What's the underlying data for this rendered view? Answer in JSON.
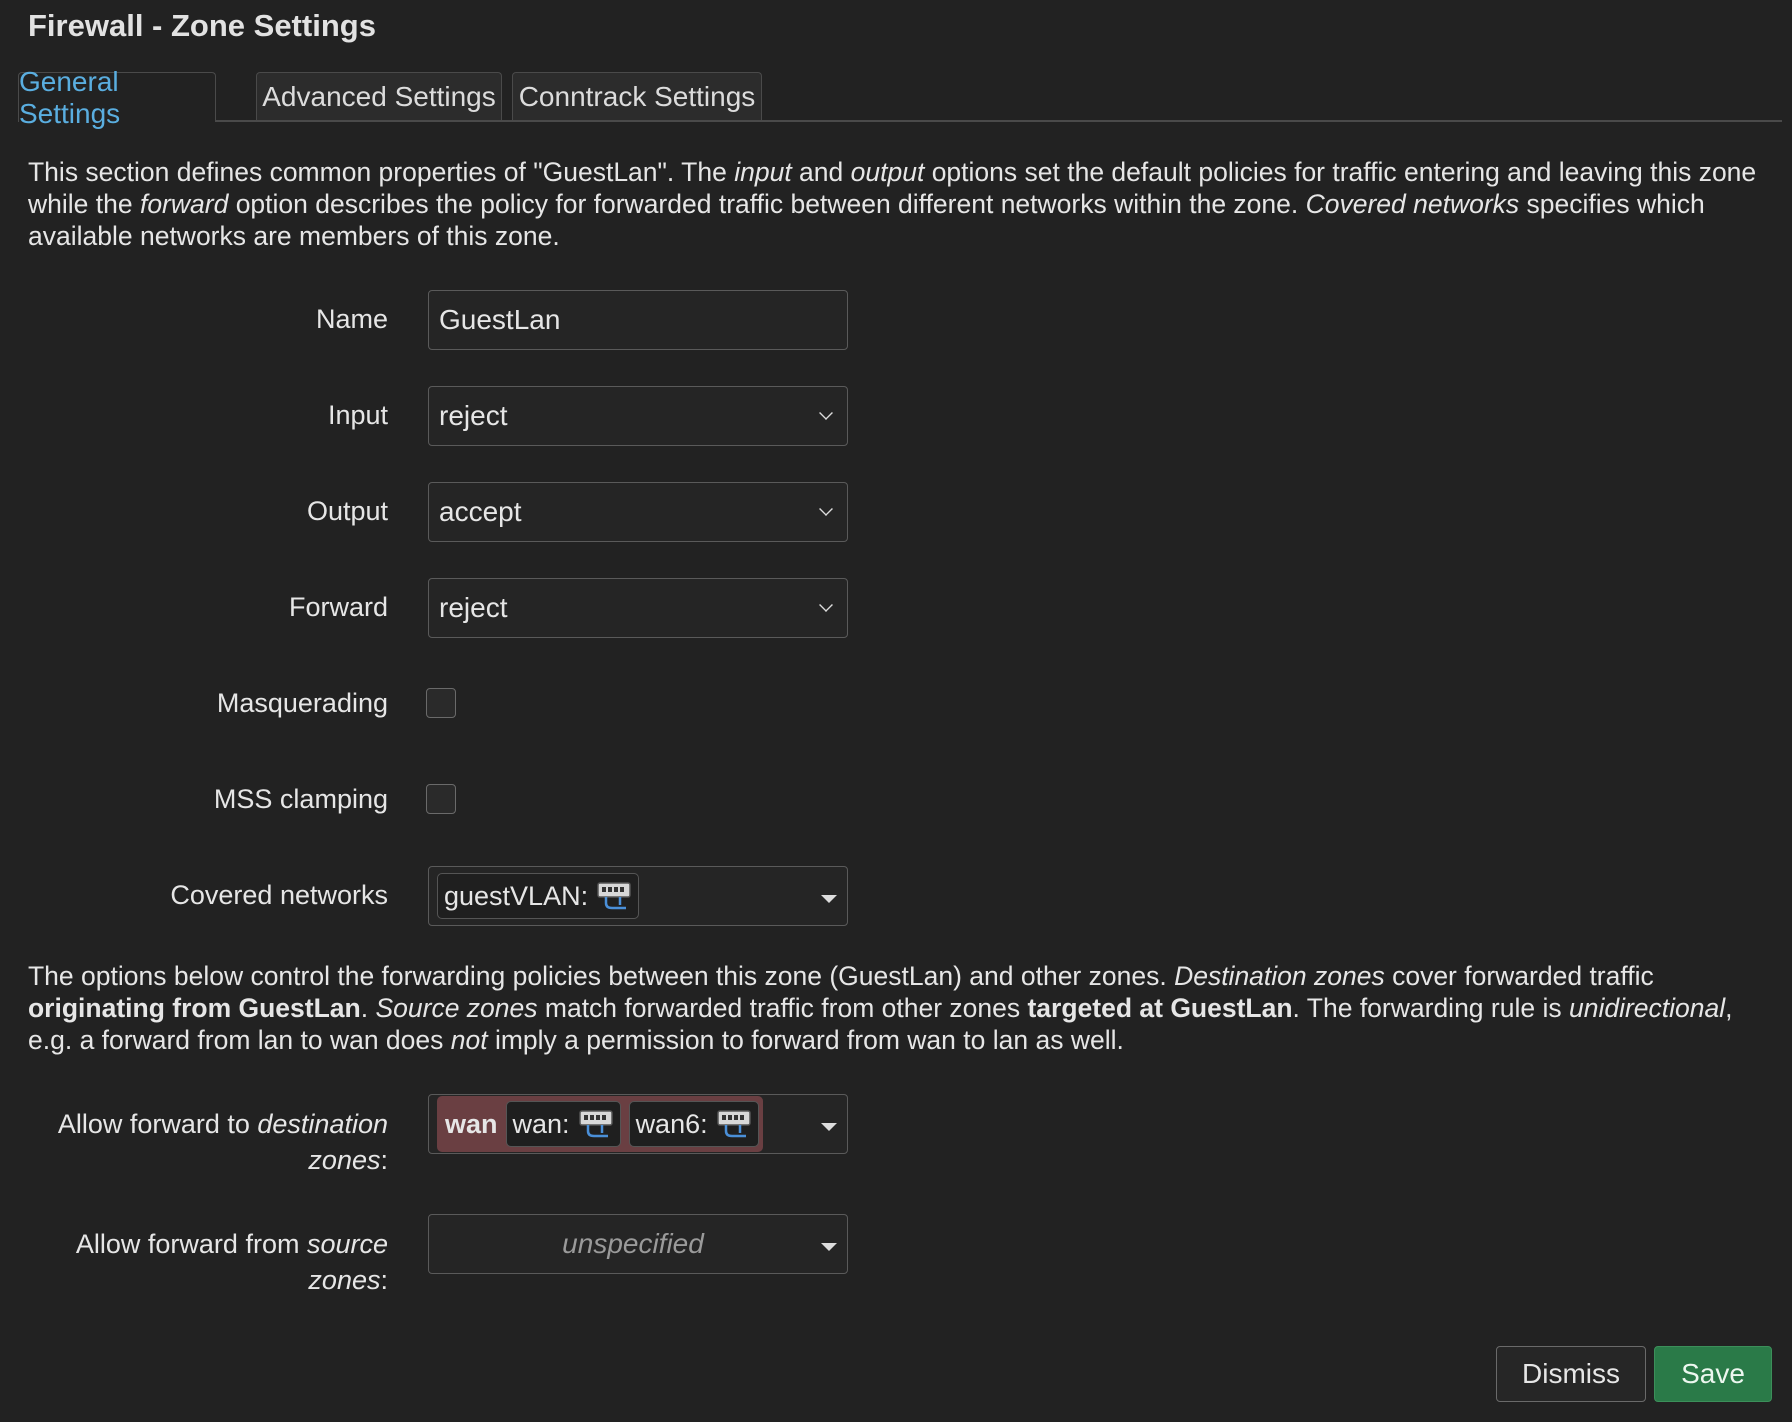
{
  "title": "Firewall - Zone Settings",
  "tabs": [
    {
      "label": "General Settings",
      "active": true
    },
    {
      "label": "Advanced Settings",
      "active": false
    },
    {
      "label": "Conntrack Settings",
      "active": false
    }
  ],
  "intro": {
    "p1": "This section defines common properties of \"GuestLan\". The ",
    "input": "input",
    "p2": " and ",
    "output": "output",
    "p3": " options set the default policies for traffic entering and leaving this zone while the ",
    "forward": "forward",
    "p4": " option describes the policy for forwarded traffic between different networks within the zone. ",
    "covered": "Covered networks",
    "p5": " specifies which available networks are members of this zone."
  },
  "form": {
    "name": {
      "label": "Name",
      "value": "GuestLan"
    },
    "input": {
      "label": "Input",
      "value": "reject"
    },
    "output": {
      "label": "Output",
      "value": "accept"
    },
    "forward": {
      "label": "Forward",
      "value": "reject"
    },
    "masquerading": {
      "label": "Masquerading",
      "checked": false
    },
    "mss_clamping": {
      "label": "MSS clamping",
      "checked": false
    },
    "covered_networks": {
      "label": "Covered networks",
      "chips": [
        "guestVLAN:"
      ],
      "icon": "network-icon"
    }
  },
  "forwarding_desc": {
    "p1": "The options below control the forwarding policies between this zone (GuestLan) and other zones. ",
    "dest": "Destination zones",
    "p2": " cover forwarded traffic ",
    "orig": "originating from GuestLan",
    "p3": ". ",
    "src": "Source zones",
    "p4": " match forwarded traffic from other zones ",
    "targ": "targeted at GuestLan",
    "p5": ". The forwarding rule is ",
    "uni": "unidirectional",
    "p6": ", e.g. a forward from lan to wan does ",
    "not": "not",
    "p7": " imply a permission to forward from wan to lan as well."
  },
  "dest_zones": {
    "label_pre": "Allow forward to ",
    "label_em": "destination zones",
    "label_post": ":",
    "zone": "wan",
    "zone_color": "#6a3f42",
    "chips": [
      "wan:",
      "wan6:"
    ]
  },
  "src_zones": {
    "label_pre": "Allow forward from ",
    "label_em": "source zones",
    "label_post": ":",
    "placeholder": "unspecified"
  },
  "buttons": {
    "dismiss": "Dismiss",
    "save": "Save"
  },
  "colors": {
    "accent": "#5aaee0",
    "save": "#2a7a48",
    "background": "#222222"
  }
}
